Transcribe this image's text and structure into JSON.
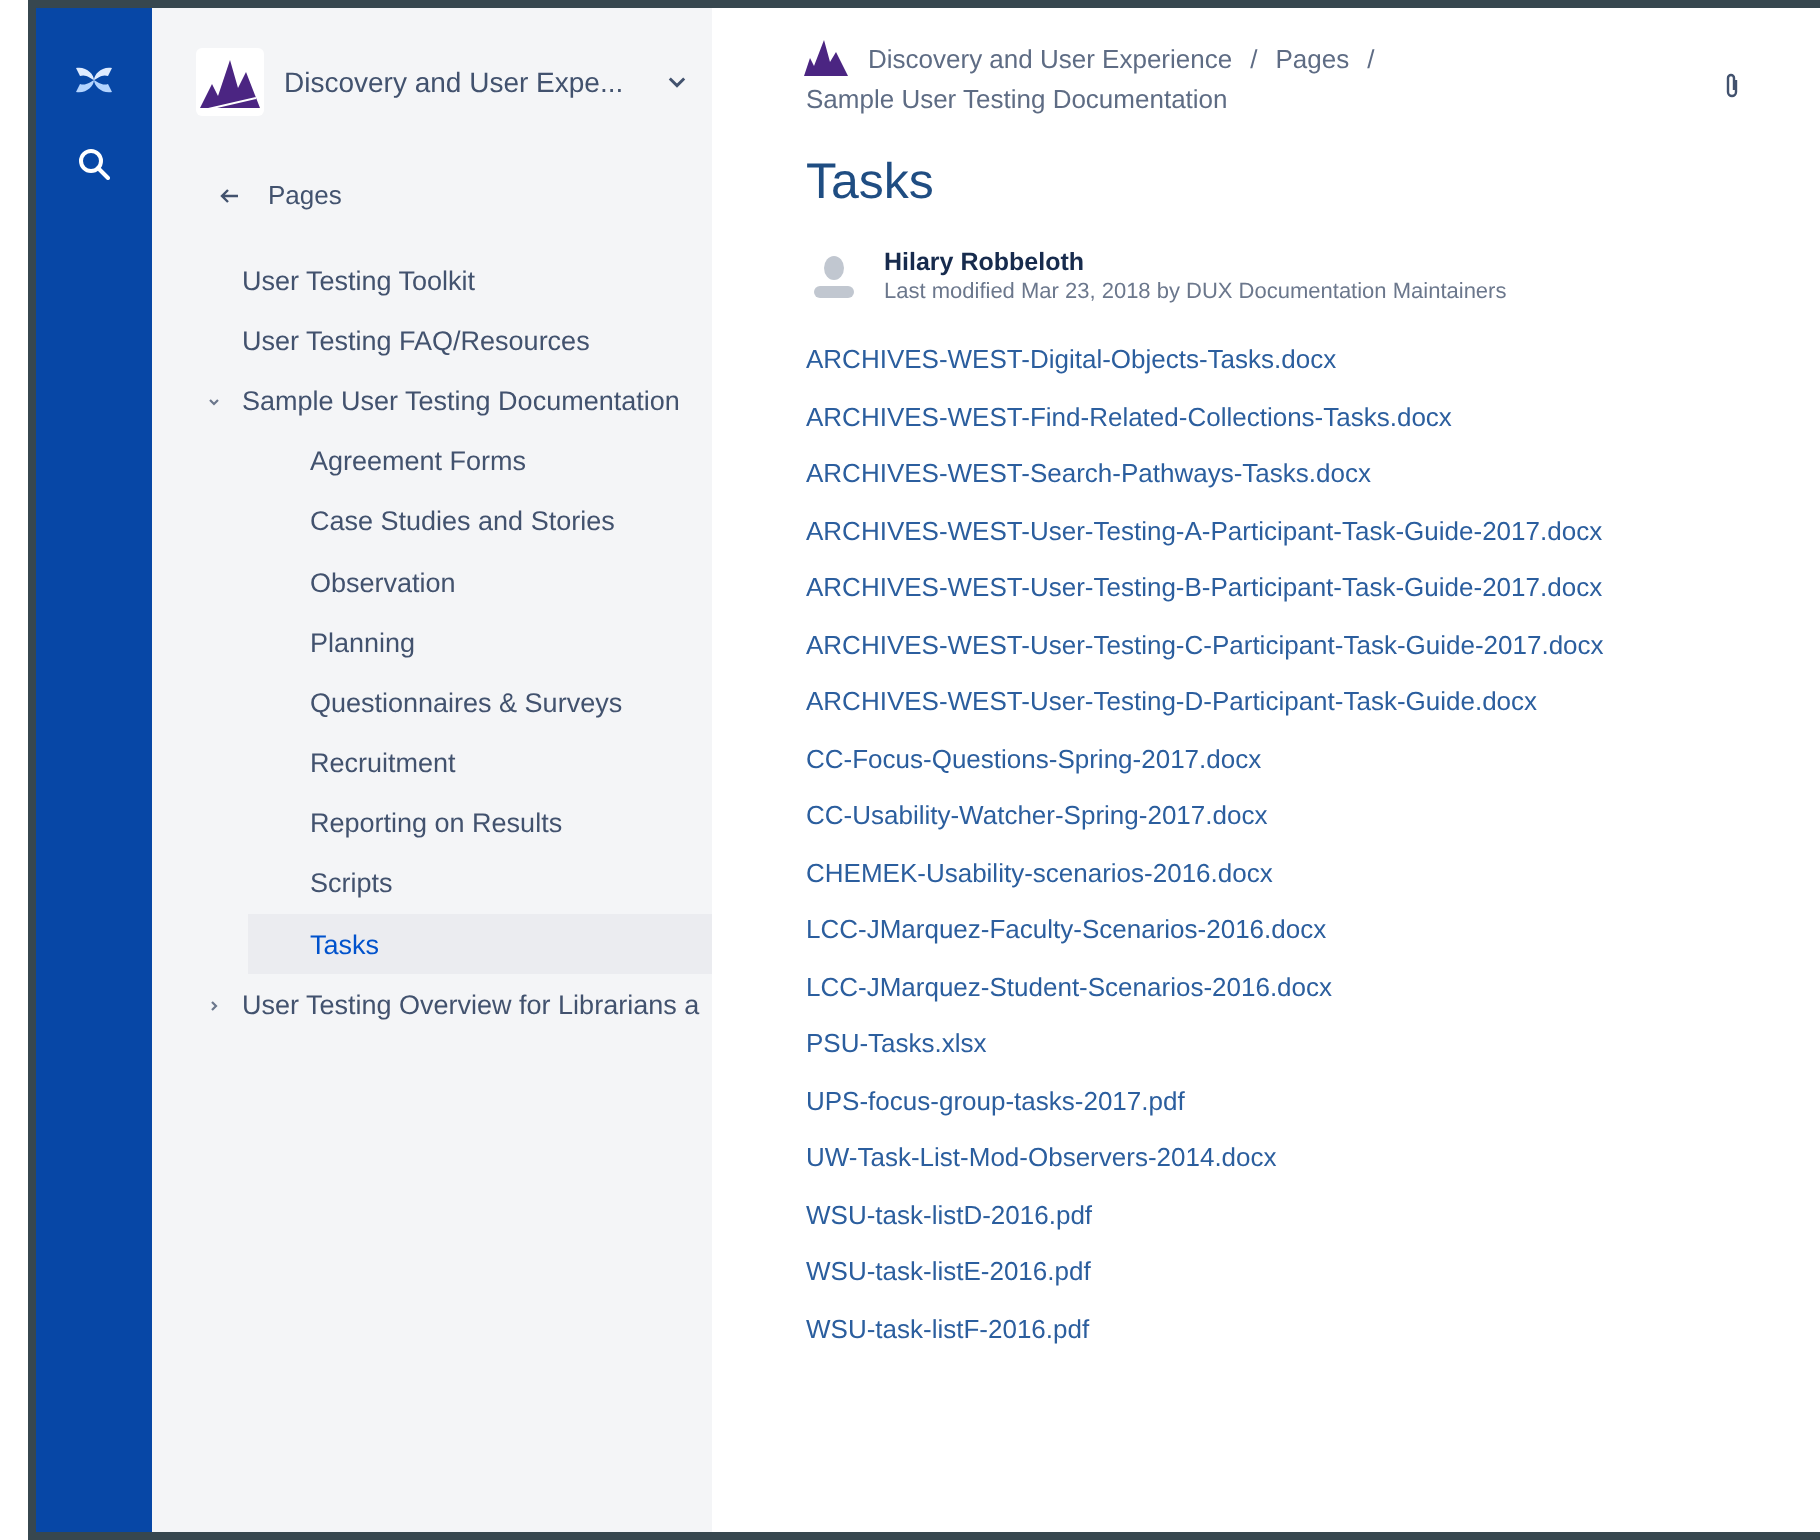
{
  "space": {
    "name": "Discovery and User Expe..."
  },
  "sidebar": {
    "back_label": "Pages",
    "items": [
      {
        "label": "User Testing Toolkit",
        "selected": false
      },
      {
        "label": "User Testing FAQ/Resources",
        "selected": false
      },
      {
        "label": "Sample User Testing Documentation",
        "selected": false,
        "expanded": true,
        "children": [
          {
            "label": "Agreement Forms",
            "selected": false
          },
          {
            "label": "Case Studies and Stories",
            "selected": false
          },
          {
            "label": "Observation",
            "selected": false
          },
          {
            "label": "Planning",
            "selected": false
          },
          {
            "label": "Questionnaires & Surveys",
            "selected": false
          },
          {
            "label": "Recruitment",
            "selected": false
          },
          {
            "label": "Reporting on Results",
            "selected": false
          },
          {
            "label": "Scripts",
            "selected": false
          },
          {
            "label": "Tasks",
            "selected": true
          }
        ]
      },
      {
        "label": "User Testing Overview for Librarians a",
        "selected": false,
        "expanded": false
      }
    ]
  },
  "breadcrumbs": [
    {
      "label": "Discovery and User Experience",
      "separator": "/"
    },
    {
      "label": "Pages",
      "separator": "/"
    },
    {
      "label": "Sample User Testing Documentation"
    }
  ],
  "page": {
    "title": "Tasks",
    "author": "Hilary Robbeloth",
    "modified": "Last modified Mar 23, 2018 by DUX Documentation Maintainers",
    "attachments": [
      "ARCHIVES-WEST-Digital-Objects-Tasks.docx",
      "ARCHIVES-WEST-Find-Related-Collections-Tasks.docx",
      "ARCHIVES-WEST-Search-Pathways-Tasks.docx",
      "ARCHIVES-WEST-User-Testing-A-Participant-Task-Guide-2017.docx",
      "ARCHIVES-WEST-User-Testing-B-Participant-Task-Guide-2017.docx",
      "ARCHIVES-WEST-User-Testing-C-Participant-Task-Guide-2017.docx",
      "ARCHIVES-WEST-User-Testing-D-Participant-Task-Guide.docx",
      "CC-Focus-Questions-Spring-2017.docx",
      "CC-Usability-Watcher-Spring-2017.docx",
      "CHEMEK-Usability-scenarios-2016.docx",
      "LCC-JMarquez-Faculty-Scenarios-2016.docx",
      "LCC-JMarquez-Student-Scenarios-2016.docx",
      "PSU-Tasks.xlsx",
      "UPS-focus-group-tasks-2017.pdf",
      "UW-Task-List-Mod-Observers-2014.docx",
      "WSU-task-listD-2016.pdf",
      "WSU-task-listE-2016.pdf",
      "WSU-task-listF-2016.pdf"
    ]
  }
}
